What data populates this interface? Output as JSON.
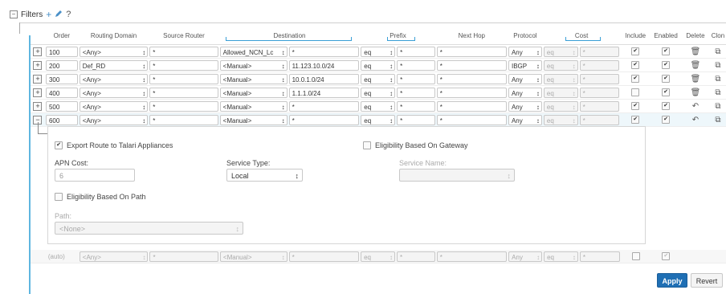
{
  "toolbar": {
    "collapse_symbol": "−",
    "title": "Filters",
    "add_symbol": "+",
    "edit_icon": "pencil-icon",
    "help_symbol": "?"
  },
  "columns": {
    "order": "Order",
    "routing_domain": "Routing Domain",
    "source_router": "Source Router",
    "destination": "Destination",
    "prefix": "Prefix",
    "next_hop": "Next Hop",
    "protocol": "Protocol",
    "cost": "Cost",
    "include": "Include",
    "enabled": "Enabled",
    "delete": "Delete",
    "clone": "Clon"
  },
  "rows": [
    {
      "exp": "+",
      "order": "100",
      "domain": "<Any>",
      "source": "*",
      "dest_type": "Allowed_NCN_Lc",
      "dest_value": "*",
      "prefix_op": "eq",
      "prefix_val": "*",
      "next_hop": "*",
      "protocol": "Any",
      "cost_op": "eq",
      "cost_val": "*",
      "include": "✔",
      "enabled": "✔",
      "action": "🗑",
      "clone": "⧉"
    },
    {
      "exp": "+",
      "order": "200",
      "domain": "Def_RD",
      "source": "*",
      "dest_type": "<Manual>",
      "dest_value": "11.123.10.0/24",
      "prefix_op": "eq",
      "prefix_val": "*",
      "next_hop": "*",
      "protocol": "IBGP",
      "cost_op": "eq",
      "cost_val": "*",
      "include": "✔",
      "enabled": "✔",
      "action": "🗑",
      "clone": "⧉"
    },
    {
      "exp": "+",
      "order": "300",
      "domain": "<Any>",
      "source": "*",
      "dest_type": "<Manual>",
      "dest_value": "10.0.1.0/24",
      "prefix_op": "eq",
      "prefix_val": "*",
      "next_hop": "*",
      "protocol": "Any",
      "cost_op": "eq",
      "cost_val": "*",
      "include": "✔",
      "enabled": "✔",
      "action": "🗑",
      "clone": "⧉"
    },
    {
      "exp": "+",
      "order": "400",
      "domain": "<Any>",
      "source": "*",
      "dest_type": "<Manual>",
      "dest_value": "1.1.1.0/24",
      "prefix_op": "eq",
      "prefix_val": "*",
      "next_hop": "*",
      "protocol": "Any",
      "cost_op": "eq",
      "cost_val": "*",
      "include": "",
      "enabled": "✔",
      "action": "🗑",
      "clone": "⧉"
    },
    {
      "exp": "+",
      "order": "500",
      "domain": "<Any>",
      "source": "*",
      "dest_type": "<Manual>",
      "dest_value": "*",
      "prefix_op": "eq",
      "prefix_val": "*",
      "next_hop": "*",
      "protocol": "Any",
      "cost_op": "eq",
      "cost_val": "*",
      "include": "✔",
      "enabled": "✔",
      "action": "↶",
      "clone": "⧉"
    },
    {
      "exp": "−",
      "order": "600",
      "domain": "<Any>",
      "source": "*",
      "dest_type": "<Manual>",
      "dest_value": "*",
      "prefix_op": "eq",
      "prefix_val": "*",
      "next_hop": "*",
      "protocol": "Any",
      "cost_op": "eq",
      "cost_val": "*",
      "include": "✔",
      "enabled": "✔",
      "action": "↶",
      "clone": "⧉"
    }
  ],
  "detail": {
    "export_label": "Export Route to Talari Appliances",
    "export_checked": "✔",
    "eligibility_gateway_label": "Eligibility Based On Gateway",
    "eligibility_gateway_checked": "",
    "apn_cost_label": "APN Cost:",
    "apn_cost_value": "6",
    "service_type_label": "Service Type:",
    "service_type_value": "Local",
    "service_name_label": "Service Name:",
    "service_name_value": "",
    "eligibility_path_label": "Eligibility Based On Path",
    "eligibility_path_checked": "",
    "path_label": "Path:",
    "path_value": "<None>"
  },
  "new_row": {
    "order": "(auto)",
    "domain": "<Any>",
    "source": "*",
    "dest_type": "<Manual>",
    "dest_value": "*",
    "prefix_op": "eq",
    "prefix_val": "*",
    "next_hop": "*",
    "protocol": "Any",
    "cost_op": "eq",
    "cost_val": "*",
    "include": "",
    "enabled": "✔"
  },
  "buttons": {
    "apply": "Apply",
    "revert": "Revert"
  },
  "colors": {
    "accent": "#5fb6e0",
    "apply_bg": "#1f6fb4"
  }
}
